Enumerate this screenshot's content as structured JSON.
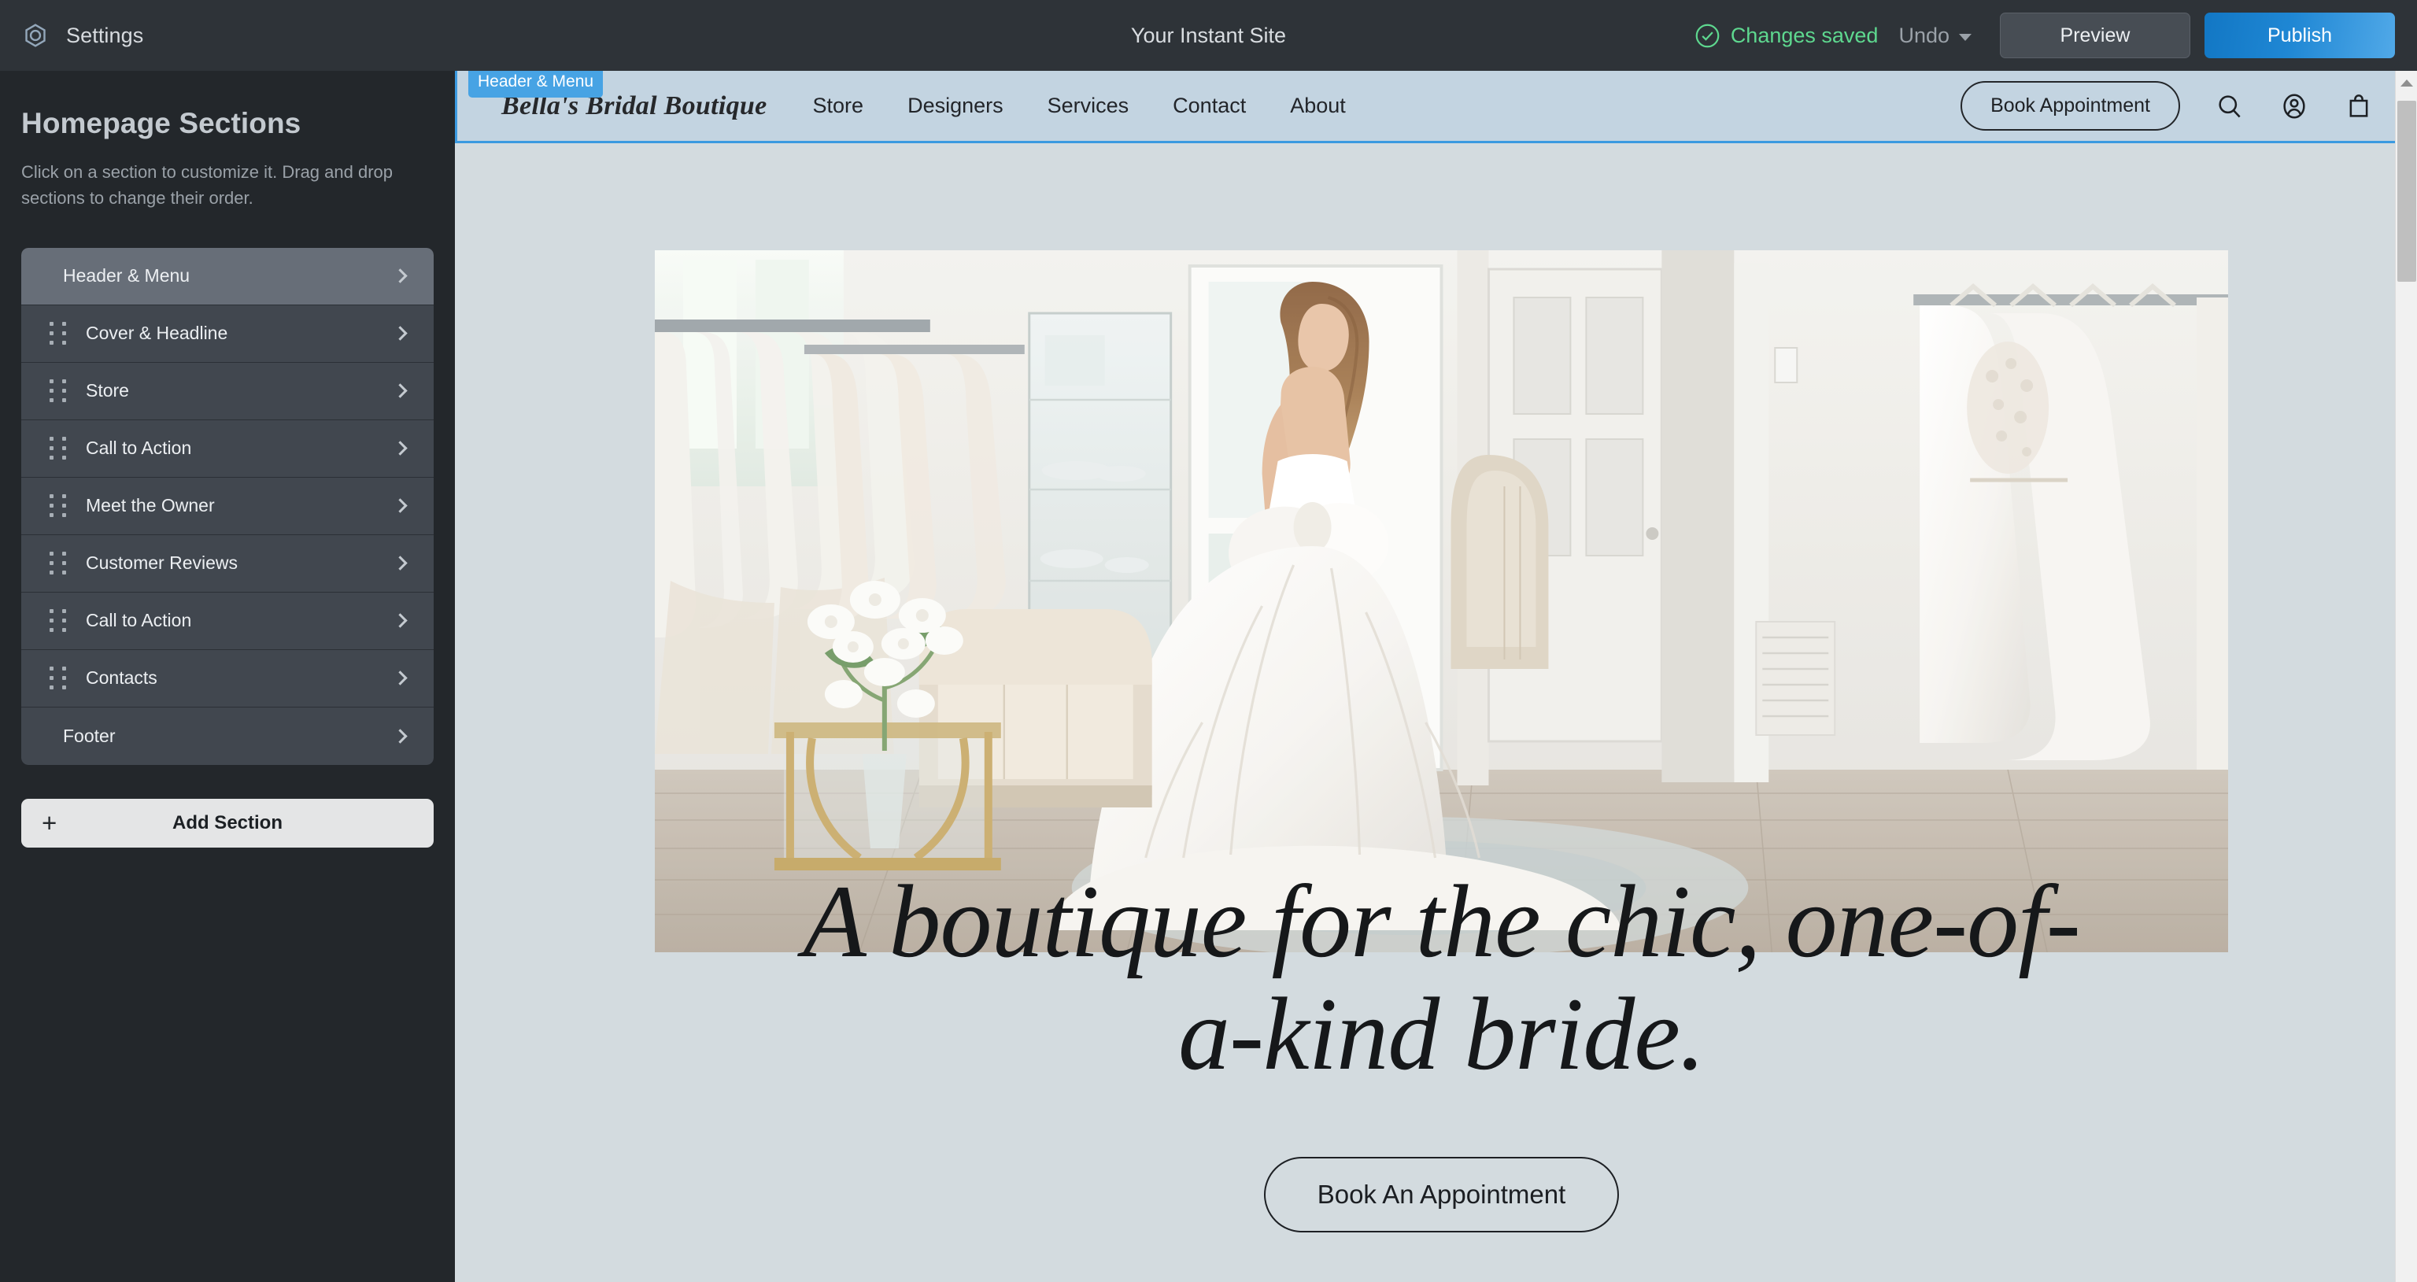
{
  "app_bar": {
    "settings_label": "Settings",
    "gear_icon": "gear-icon",
    "title": "Your Instant Site",
    "status_text": "Changes saved",
    "status_color": "#5ed88f",
    "check_icon": "check-circle-icon",
    "undo_label": "Undo",
    "undo_chevron_icon": "chevron-down-icon",
    "preview_label": "Preview",
    "publish_label": "Publish",
    "publish_color": "#1f87d4"
  },
  "sidebar": {
    "title": "Homepage Sections",
    "description": "Click on a section to customize it. Drag and drop sections to change their order.",
    "sections": [
      {
        "label": "Header & Menu",
        "active": true,
        "draggable": false
      },
      {
        "label": "Cover & Headline",
        "active": false,
        "draggable": true
      },
      {
        "label": "Store",
        "active": false,
        "draggable": true
      },
      {
        "label": "Call to Action",
        "active": false,
        "draggable": true
      },
      {
        "label": "Meet the Owner",
        "active": false,
        "draggable": true
      },
      {
        "label": "Customer Reviews",
        "active": false,
        "draggable": true
      },
      {
        "label": "Call to Action",
        "active": false,
        "draggable": true
      },
      {
        "label": "Contacts",
        "active": false,
        "draggable": true
      },
      {
        "label": "Footer",
        "active": false,
        "draggable": false
      }
    ],
    "add_section_label": "Add Section",
    "add_section_icon": "plus-icon"
  },
  "canvas": {
    "selected_section_badge": "Header & Menu",
    "selection_color": "#3b9ae0",
    "background_color": "#d3dbdf",
    "site_header": {
      "background_color": "#c3d4e1",
      "logo": "Bella's Bridal Boutique",
      "nav_items": [
        "Store",
        "Designers",
        "Services",
        "Contact",
        "About"
      ],
      "cta_label": "Book Appointment",
      "icons": [
        "search-icon",
        "account-icon",
        "shopping-bag-icon"
      ]
    },
    "hero": {
      "image_alt": "Bride in a white gown with large bow standing in a bridal boutique showroom",
      "headline": "A boutique for the chic, one-of-\na-kind bride.",
      "cta_label": "Book An Appointment"
    }
  }
}
